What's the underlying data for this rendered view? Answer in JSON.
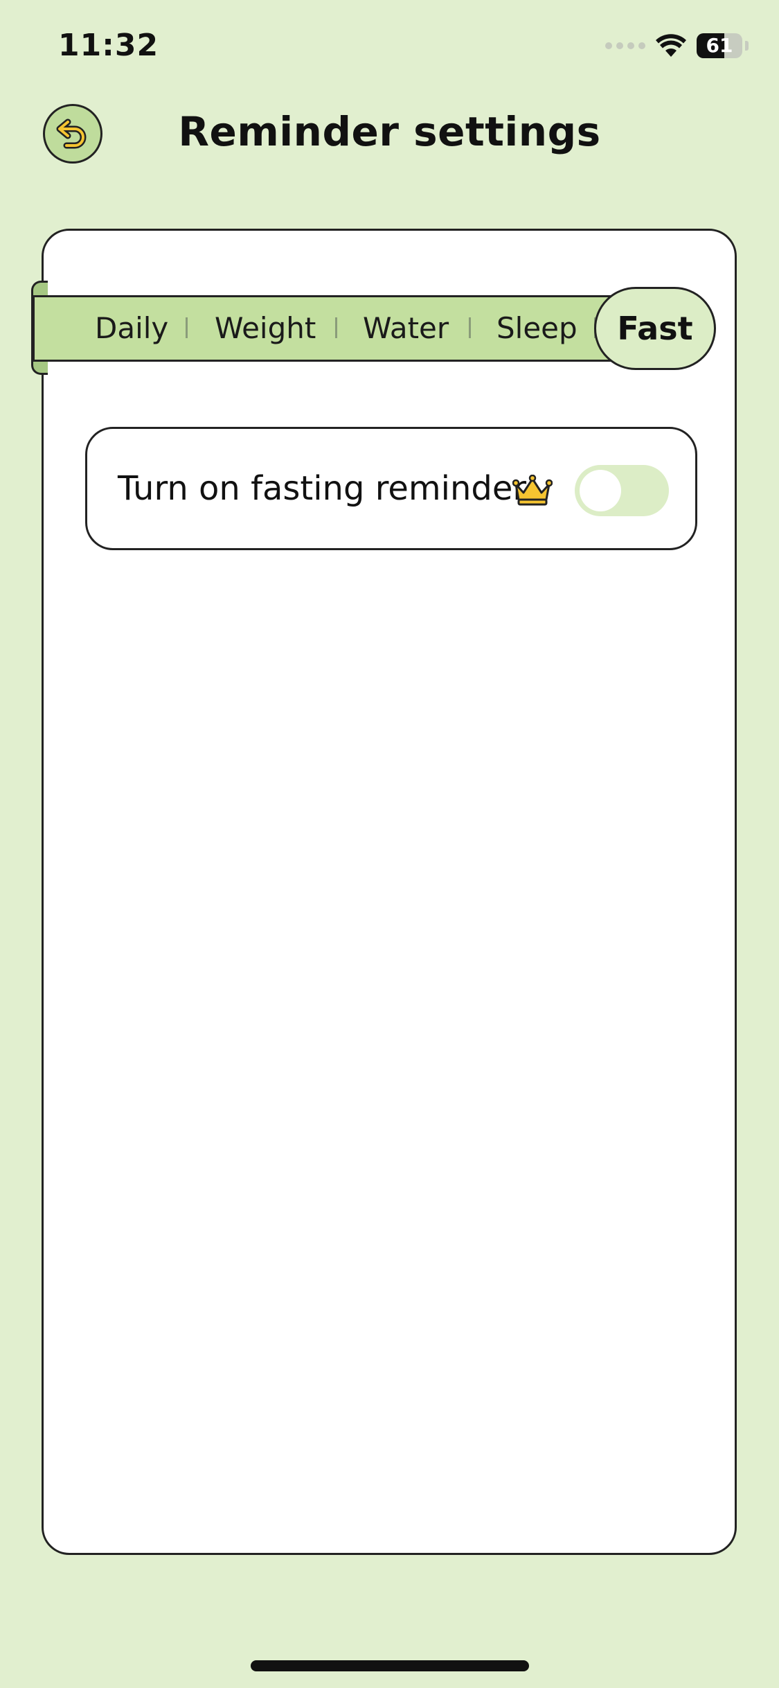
{
  "status_bar": {
    "time": "11:32",
    "battery": "61",
    "battery_level_percent": 61
  },
  "header": {
    "title": "Reminder settings",
    "back_icon": "back-arrow-icon"
  },
  "tabs": {
    "items": [
      {
        "label": "Daily"
      },
      {
        "label": "Weight"
      },
      {
        "label": "Water"
      },
      {
        "label": "Sleep"
      },
      {
        "label": "Fast"
      }
    ],
    "selected": "Fast"
  },
  "setting": {
    "label": "Turn on fasting reminder",
    "premium_icon": "crown-icon",
    "toggle_on": false
  },
  "colors": {
    "background": "#e1efcf",
    "accent_green": "#c3df9f",
    "active_tab": "#dcedc6",
    "crown_gold": "#f5c431"
  }
}
